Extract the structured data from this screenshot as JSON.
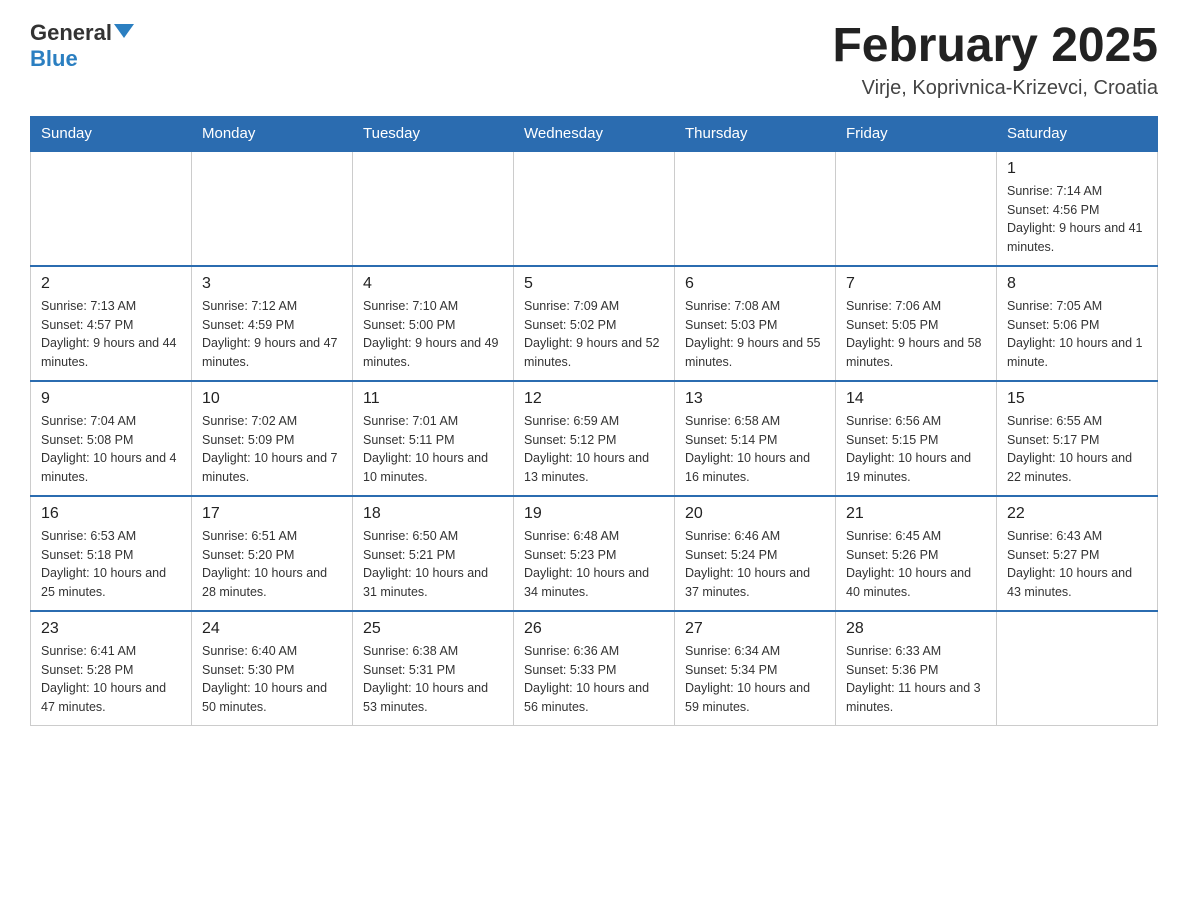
{
  "header": {
    "logo_general": "General",
    "logo_blue": "Blue",
    "month_title": "February 2025",
    "location": "Virje, Koprivnica-Krizevci, Croatia"
  },
  "days_of_week": [
    "Sunday",
    "Monday",
    "Tuesday",
    "Wednesday",
    "Thursday",
    "Friday",
    "Saturday"
  ],
  "weeks": [
    {
      "days": [
        {
          "number": "",
          "info": ""
        },
        {
          "number": "",
          "info": ""
        },
        {
          "number": "",
          "info": ""
        },
        {
          "number": "",
          "info": ""
        },
        {
          "number": "",
          "info": ""
        },
        {
          "number": "",
          "info": ""
        },
        {
          "number": "1",
          "info": "Sunrise: 7:14 AM\nSunset: 4:56 PM\nDaylight: 9 hours and 41 minutes."
        }
      ]
    },
    {
      "days": [
        {
          "number": "2",
          "info": "Sunrise: 7:13 AM\nSunset: 4:57 PM\nDaylight: 9 hours and 44 minutes."
        },
        {
          "number": "3",
          "info": "Sunrise: 7:12 AM\nSunset: 4:59 PM\nDaylight: 9 hours and 47 minutes."
        },
        {
          "number": "4",
          "info": "Sunrise: 7:10 AM\nSunset: 5:00 PM\nDaylight: 9 hours and 49 minutes."
        },
        {
          "number": "5",
          "info": "Sunrise: 7:09 AM\nSunset: 5:02 PM\nDaylight: 9 hours and 52 minutes."
        },
        {
          "number": "6",
          "info": "Sunrise: 7:08 AM\nSunset: 5:03 PM\nDaylight: 9 hours and 55 minutes."
        },
        {
          "number": "7",
          "info": "Sunrise: 7:06 AM\nSunset: 5:05 PM\nDaylight: 9 hours and 58 minutes."
        },
        {
          "number": "8",
          "info": "Sunrise: 7:05 AM\nSunset: 5:06 PM\nDaylight: 10 hours and 1 minute."
        }
      ]
    },
    {
      "days": [
        {
          "number": "9",
          "info": "Sunrise: 7:04 AM\nSunset: 5:08 PM\nDaylight: 10 hours and 4 minutes."
        },
        {
          "number": "10",
          "info": "Sunrise: 7:02 AM\nSunset: 5:09 PM\nDaylight: 10 hours and 7 minutes."
        },
        {
          "number": "11",
          "info": "Sunrise: 7:01 AM\nSunset: 5:11 PM\nDaylight: 10 hours and 10 minutes."
        },
        {
          "number": "12",
          "info": "Sunrise: 6:59 AM\nSunset: 5:12 PM\nDaylight: 10 hours and 13 minutes."
        },
        {
          "number": "13",
          "info": "Sunrise: 6:58 AM\nSunset: 5:14 PM\nDaylight: 10 hours and 16 minutes."
        },
        {
          "number": "14",
          "info": "Sunrise: 6:56 AM\nSunset: 5:15 PM\nDaylight: 10 hours and 19 minutes."
        },
        {
          "number": "15",
          "info": "Sunrise: 6:55 AM\nSunset: 5:17 PM\nDaylight: 10 hours and 22 minutes."
        }
      ]
    },
    {
      "days": [
        {
          "number": "16",
          "info": "Sunrise: 6:53 AM\nSunset: 5:18 PM\nDaylight: 10 hours and 25 minutes."
        },
        {
          "number": "17",
          "info": "Sunrise: 6:51 AM\nSunset: 5:20 PM\nDaylight: 10 hours and 28 minutes."
        },
        {
          "number": "18",
          "info": "Sunrise: 6:50 AM\nSunset: 5:21 PM\nDaylight: 10 hours and 31 minutes."
        },
        {
          "number": "19",
          "info": "Sunrise: 6:48 AM\nSunset: 5:23 PM\nDaylight: 10 hours and 34 minutes."
        },
        {
          "number": "20",
          "info": "Sunrise: 6:46 AM\nSunset: 5:24 PM\nDaylight: 10 hours and 37 minutes."
        },
        {
          "number": "21",
          "info": "Sunrise: 6:45 AM\nSunset: 5:26 PM\nDaylight: 10 hours and 40 minutes."
        },
        {
          "number": "22",
          "info": "Sunrise: 6:43 AM\nSunset: 5:27 PM\nDaylight: 10 hours and 43 minutes."
        }
      ]
    },
    {
      "days": [
        {
          "number": "23",
          "info": "Sunrise: 6:41 AM\nSunset: 5:28 PM\nDaylight: 10 hours and 47 minutes."
        },
        {
          "number": "24",
          "info": "Sunrise: 6:40 AM\nSunset: 5:30 PM\nDaylight: 10 hours and 50 minutes."
        },
        {
          "number": "25",
          "info": "Sunrise: 6:38 AM\nSunset: 5:31 PM\nDaylight: 10 hours and 53 minutes."
        },
        {
          "number": "26",
          "info": "Sunrise: 6:36 AM\nSunset: 5:33 PM\nDaylight: 10 hours and 56 minutes."
        },
        {
          "number": "27",
          "info": "Sunrise: 6:34 AM\nSunset: 5:34 PM\nDaylight: 10 hours and 59 minutes."
        },
        {
          "number": "28",
          "info": "Sunrise: 6:33 AM\nSunset: 5:36 PM\nDaylight: 11 hours and 3 minutes."
        },
        {
          "number": "",
          "info": ""
        }
      ]
    }
  ]
}
